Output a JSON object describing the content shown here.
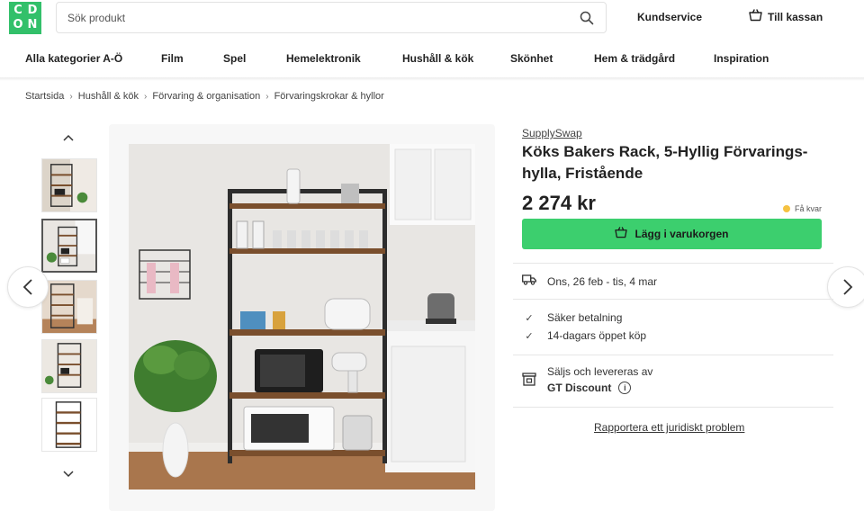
{
  "logo": {
    "letters": [
      "C",
      "D",
      "O",
      "N"
    ]
  },
  "header": {
    "search_placeholder": "Sök produkt",
    "customer_service": "Kundservice",
    "checkout": "Till kassan"
  },
  "nav": {
    "items": [
      "Alla kategorier A-Ö",
      "Film",
      "Spel",
      "Hemelektronik",
      "Hushåll & kök",
      "Skönhet",
      "Hem & trädgård",
      "Inspiration"
    ]
  },
  "breadcrumb": [
    "Startsida",
    "Hushåll & kök",
    "Förvaring & organisation",
    "Förvaringskrokar & hyllor"
  ],
  "product": {
    "brand": "SupplySwap",
    "title": "Köks Bakers Rack, 5-Hyllig Förvarings-hylla, Fristående",
    "price": "2 274 kr",
    "stock_label": "Få kvar",
    "buy_label": "Lägg i varukorgen"
  },
  "delivery": {
    "text": "Ons, 26 feb - tis, 4 mar"
  },
  "benefits": [
    "Säker betalning",
    "14-dagars öppet köp"
  ],
  "seller": {
    "label": "Säljs och levereras av",
    "name": "GT Discount"
  },
  "report_link": "Rapportera ett juridiskt problem",
  "icons": {
    "search": "search-icon",
    "cart": "cart-icon",
    "truck": "truck-icon",
    "check": "check-icon",
    "store": "store-icon",
    "info": "info-icon"
  },
  "colors": {
    "brand_green": "#32c06a",
    "buy_button": "#3ccf6e",
    "stock_dot": "#f5c242"
  }
}
